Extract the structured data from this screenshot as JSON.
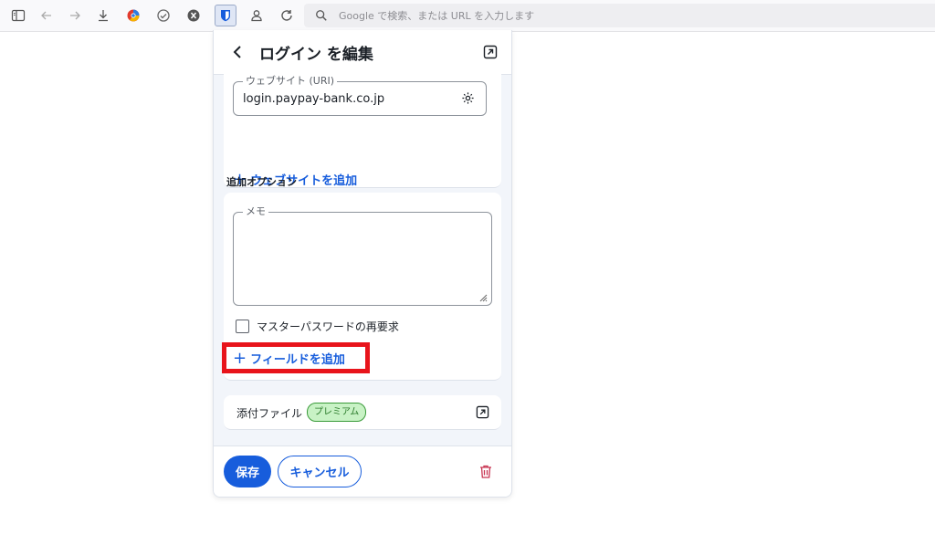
{
  "browser": {
    "address_placeholder": "Google で検索、または URL を入力します",
    "toolbar_icons": [
      "sidebar-icon",
      "back-icon",
      "forward-icon",
      "download-icon",
      "extension-icon-color",
      "extension-icon-shield",
      "extension-icon-x",
      "bitwarden-icon",
      "extension-icon-person",
      "reload-icon"
    ]
  },
  "popup": {
    "title": "ログイン を編集",
    "website_section": {
      "uri_label": "ウェブサイト (URI)",
      "uri_value": "login.paypay-bank.co.jp",
      "add_website_label": "ウェブサイトを追加"
    },
    "options_section": {
      "heading": "追加オプション",
      "memo_label": "メモ",
      "memo_value": "",
      "reprompt_label": "マスターパスワードの再要求",
      "reprompt_checked": false,
      "add_field_label": "フィールドを追加"
    },
    "attachments": {
      "label": "添付ファイル",
      "badge": "プレミアム"
    },
    "footer": {
      "save_label": "保存",
      "cancel_label": "キャンセル"
    }
  },
  "colors": {
    "accent": "#175ddc",
    "highlight": "#e8141b",
    "premium_bg": "#c8f2c5",
    "danger": "#c83552"
  }
}
